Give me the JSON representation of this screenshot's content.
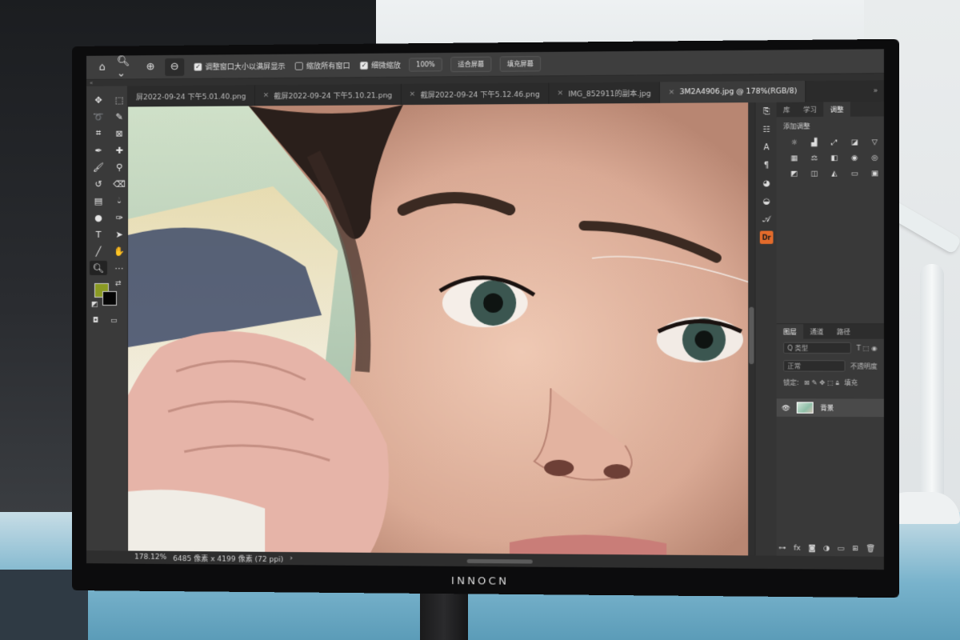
{
  "options_bar": {
    "resize_windows_label": "调整窗口大小以满屏显示",
    "resize_windows_checked": true,
    "zoom_all_windows_label": "缩放所有窗口",
    "zoom_all_windows_checked": false,
    "scrubby_zoom_label": "细微缩放",
    "scrubby_zoom_checked": true,
    "zoom_100_label": "100%",
    "fit_screen_label": "适合屏幕",
    "fill_screen_label": "填充屏幕"
  },
  "tabs": [
    {
      "label": "屏2022-09-24 下午5.01.40.png",
      "active": false
    },
    {
      "label": "截屏2022-09-24 下午5.10.21.png",
      "active": false
    },
    {
      "label": "截屏2022-09-24 下午5.12.46.png",
      "active": false
    },
    {
      "label": "IMG_852911的副本.jpg",
      "active": false
    },
    {
      "label": "3M2A4906.jpg @ 178%(RGB/8)",
      "active": true
    }
  ],
  "colors": {
    "foreground": "#8a9a23",
    "background": "#050505"
  },
  "panels": {
    "top_tabs": [
      "库",
      "学习",
      "调整"
    ],
    "adjustments_heading": "添加调整",
    "layer_tabs": [
      "图层",
      "通道",
      "路径"
    ],
    "kind_label": "Q 类型",
    "blend_mode": "正常",
    "opacity_label": "不透明度",
    "lock_label": "锁定:",
    "fill_label": "填充",
    "layer_name": "背景"
  },
  "status": {
    "zoom": "178.12%",
    "dimensions": "6485 像素 x 4199 像素 (72 ppi)"
  },
  "monitor": {
    "brand": "INNOCN"
  }
}
